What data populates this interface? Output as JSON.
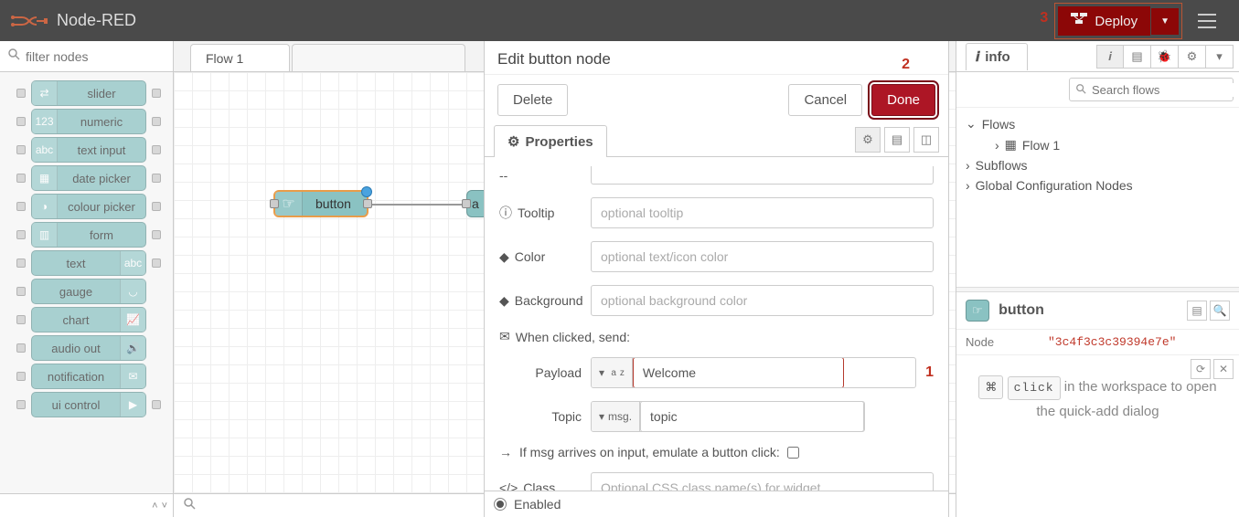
{
  "app": {
    "title": "Node-RED"
  },
  "header": {
    "deploy_label": "Deploy"
  },
  "annotations": {
    "one": "1",
    "two": "2",
    "three": "3"
  },
  "palette": {
    "filter_placeholder": "filter nodes",
    "nodes": [
      {
        "label": "slider"
      },
      {
        "label": "numeric"
      },
      {
        "label": "text input"
      },
      {
        "label": "date picker"
      },
      {
        "label": "colour picker"
      },
      {
        "label": "form"
      },
      {
        "label": "text"
      },
      {
        "label": "gauge"
      },
      {
        "label": "chart"
      },
      {
        "label": "audio out"
      },
      {
        "label": "notification"
      },
      {
        "label": "ui control"
      }
    ]
  },
  "workspace": {
    "tab": "Flow 1",
    "button_node_label": "button"
  },
  "edit": {
    "title": "Edit button node",
    "delete": "Delete",
    "cancel": "Cancel",
    "done": "Done",
    "properties": "Properties",
    "dashdash": "--",
    "tooltip_label": "Tooltip",
    "tooltip_placeholder": "optional tooltip",
    "color_label": "Color",
    "color_placeholder": "optional text/icon color",
    "bg_label": "Background",
    "bg_placeholder": "optional background color",
    "when_clicked": "When clicked, send:",
    "payload_label": "Payload",
    "payload_value": "Welcome",
    "topic_label": "Topic",
    "topic_prefix": "msg.",
    "topic_value": "topic",
    "emulate": "If msg arrives on input, emulate a button click:",
    "class_label": "Class",
    "class_placeholder": "Optional CSS class name(s) for widget",
    "enabled": "Enabled"
  },
  "sidebar": {
    "info": "info",
    "search_placeholder": "Search flows",
    "tree": {
      "flows": "Flows",
      "flow1": "Flow 1",
      "subflows": "Subflows",
      "global": "Global Configuration Nodes"
    },
    "node_chip": "button",
    "node_key": "Node",
    "node_id": "\"3c4f3c3c39394e7e\"",
    "hint_pre": " in the workspace to open the quick-add dialog",
    "kbd_cmd": "⌘",
    "kbd_click": "click"
  }
}
